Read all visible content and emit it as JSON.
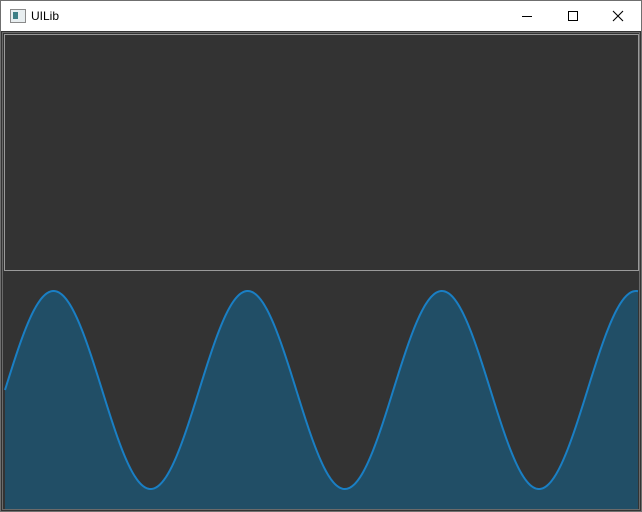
{
  "window": {
    "title": "UILib",
    "controls": [
      "minimize",
      "maximize",
      "close"
    ]
  },
  "colors": {
    "background": "#333333",
    "line": "#1a7fc4",
    "fill": "#214e66",
    "panel_border": "#9a9a9a"
  },
  "chart_data": {
    "type": "area",
    "waveform": "sine",
    "cycles": 3.26,
    "phase_deg": 0,
    "amplitude": 1,
    "ylim": [
      -1,
      1
    ],
    "grid": false,
    "legend": "none"
  }
}
